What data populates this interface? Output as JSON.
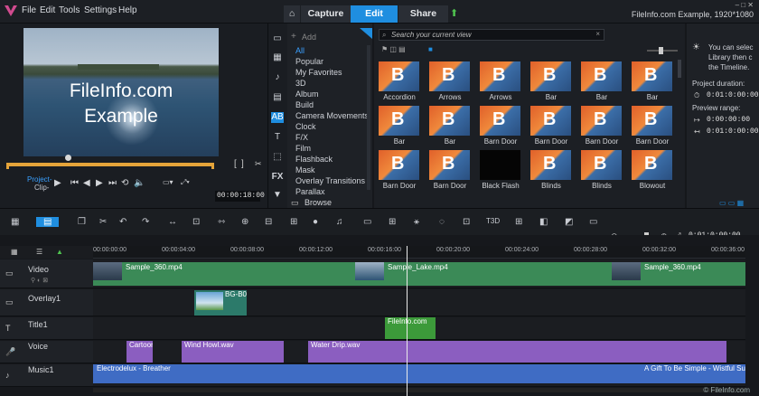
{
  "menu": {
    "items": [
      "File",
      "Edit",
      "Tools",
      "Settings",
      "Help"
    ]
  },
  "tabs": {
    "capture": "Capture",
    "edit": "Edit",
    "share": "Share"
  },
  "window_title": "FileInfo.com Example, 1920*1080",
  "preview": {
    "text_line1": "FileInfo.com",
    "text_line2": "Example"
  },
  "player": {
    "project_label": "Project-",
    "clip_label": "Clip-",
    "timecode": "00:00:18:00"
  },
  "library": {
    "add_label": "Add",
    "search_placeholder": "Search your current view",
    "categories": [
      "All",
      "Popular",
      "My Favorites",
      "3D",
      "Album",
      "Build",
      "Camera Movements",
      "Clock",
      "F/X",
      "Film",
      "Flashback",
      "Mask",
      "Overlay Transitions",
      "Parallax"
    ],
    "browse_label": "Browse",
    "thumb_labels_row1": [
      "Accordion",
      "Arrows",
      "Arrows",
      "Bar",
      "Bar",
      "Bar"
    ],
    "thumb_labels_row2": [
      "Bar",
      "Bar",
      "Barn Door",
      "Barn Door",
      "Barn Door",
      "Barn Door"
    ],
    "thumb_labels_row3": [
      "Barn Door",
      "Barn Door",
      "Black Flash",
      "Blinds",
      "Blinds",
      "Blowout"
    ]
  },
  "info": {
    "hint_line1": "You can selec",
    "hint_line2": "Library then c",
    "hint_line3": "the Timeline.",
    "project_duration_label": "Project duration:",
    "project_duration": "0:01:0:00:00",
    "preview_range_label": "Preview range:",
    "range_start": "0:00:00:00",
    "range_end": "0:01:0:00:00"
  },
  "timeline": {
    "ruler_ticks": [
      "00:00:00:00",
      "00:00:04:00",
      "00:00:08:00",
      "00:00:12:00",
      "00:00:16:00",
      "00:00:20:00",
      "00:00:24:00",
      "00:00:28:00",
      "00:00:32:00",
      "00:00:36:00"
    ],
    "tracks": {
      "video": "Video",
      "overlay": "Overlay1",
      "title": "Title1",
      "voice": "Voice",
      "music": "Music1"
    },
    "clips": {
      "video1": "Sample_360.mp4",
      "video2": "Sample_Lake.mp4",
      "video3": "Sample_360.mp4",
      "overlay1": "BG-B0",
      "title1": "FileInfo.com",
      "voice1": "Cartoon",
      "voice2": "Wind Howl.wav",
      "voice3": "Water Drip.wav",
      "music1": "Electrodelux - Breather",
      "music2": "A Gift To Be Simple - Wistful Sunse"
    }
  },
  "watermark": "© FileInfo.com",
  "colors": {
    "accent": "#1f8ee0",
    "video_clip": "#3b8a57",
    "overlay_clip": "#2c7a6a",
    "title_clip": "#3c9a3a",
    "voice_clip": "#8b5ec0",
    "music_clip": "#3f6cc4",
    "scrubbar": "#e5a43a"
  }
}
